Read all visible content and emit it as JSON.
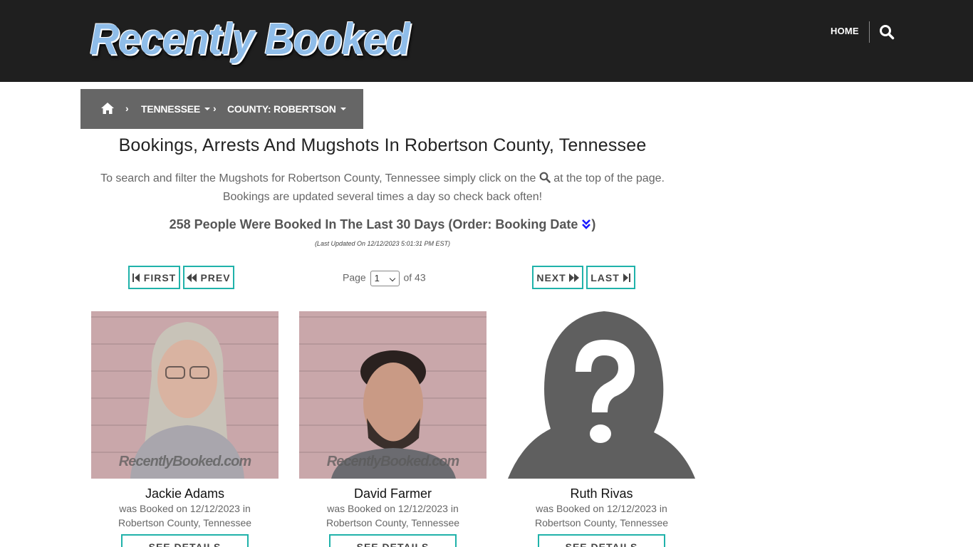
{
  "header": {
    "logo_text": "Recently Booked",
    "nav_home": "HOME",
    "search_icon": "search-icon"
  },
  "breadcrumb": {
    "home_icon": "home-icon",
    "state": "TENNESSEE",
    "county": "COUNTY: ROBERTSON"
  },
  "page": {
    "title": "Bookings, Arrests And Mugshots In Robertson County, Tennessee",
    "intro_part1": "To search and filter the Mugshots for Robertson County, Tennessee simply click on the",
    "intro_part2": "at the top of the page.",
    "intro_line2": "Bookings are updated several times a day so check back often!",
    "count_text": "258 People Were Booked In The Last 30 Days (Order: Booking Date",
    "count_close": ")",
    "updated": "(Last Updated On 12/12/2023 5:01:31 PM EST)"
  },
  "pager": {
    "first": "FIRST",
    "prev": "PREV",
    "next": "NEXT",
    "last": "LAST",
    "page_label": "Page",
    "page_value": "1",
    "of_label": "of 43"
  },
  "bookings": [
    {
      "name": "Jackie Adams",
      "line1": "was Booked on 12/12/2023 in",
      "line2": "Robertson County, Tennessee",
      "watermark": "RecentlyBooked.com",
      "button": "SEE DETAILS"
    },
    {
      "name": "David Farmer",
      "line1": "was Booked on 12/12/2023 in",
      "line2": "Robertson County, Tennessee",
      "watermark": "RecentlyBooked.com",
      "button": "SEE DETAILS"
    },
    {
      "name": "Ruth Rivas",
      "line1": "was Booked on 12/12/2023 in",
      "line2": "Robertson County, Tennessee",
      "watermark": "",
      "button": "SEE DETAILS"
    }
  ],
  "colors": {
    "header_bg": "#1f1f1f",
    "breadcrumb_bg": "#666666",
    "accent_teal": "#20b2aa",
    "order_icon": "#1a1aff"
  }
}
